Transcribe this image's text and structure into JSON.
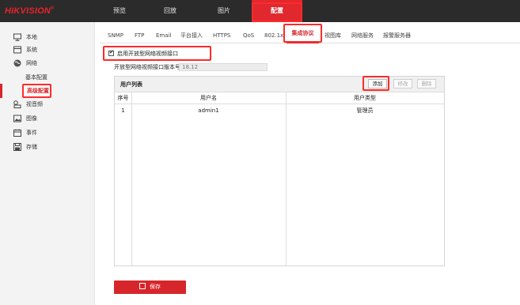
{
  "app": {
    "logo_text": "HIKVISION",
    "logo_reg": "®"
  },
  "nav": {
    "items": [
      "预览",
      "回放",
      "图片",
      "配置"
    ],
    "active": "配置"
  },
  "sidebar": {
    "items": [
      {
        "label": "本地",
        "icon": "monitor-icon"
      },
      {
        "label": "系统",
        "icon": "system-icon"
      },
      {
        "label": "网络",
        "icon": "globe-icon"
      },
      {
        "label": "视音频",
        "icon": "audio-video-icon"
      },
      {
        "label": "图像",
        "icon": "image-icon"
      },
      {
        "label": "事件",
        "icon": "calendar-icon"
      },
      {
        "label": "存储",
        "icon": "storage-icon"
      }
    ],
    "network_sub": [
      "基本配置",
      "高级配置"
    ],
    "active_sub": "高级配置"
  },
  "tabs": {
    "items": [
      "SNMP",
      "FTP",
      "Email",
      "平台接入",
      "HTTPS",
      "QoS",
      "802.1x",
      "集成协议",
      "视图库",
      "网络服务",
      "报警服务器"
    ],
    "active": "集成协议"
  },
  "form": {
    "enable_label": "启用开放型网络视频接口",
    "enable_checked": true,
    "version_label": "开放型网络视频接口版本号",
    "version_value": "18.12"
  },
  "user_list": {
    "title": "用户列表",
    "buttons": {
      "add": "添加",
      "edit": "修改",
      "delete": "删除"
    },
    "columns": [
      "序号",
      "用户名",
      "用户类型"
    ],
    "rows": [
      {
        "index": "1",
        "username": "admin1",
        "user_type": "管理员"
      }
    ]
  },
  "save_label": "保存",
  "colors": {
    "brand_red": "#d7262b",
    "highlight_outline": "#ff2a2a",
    "topbar_bg": "#2b2b2b"
  }
}
